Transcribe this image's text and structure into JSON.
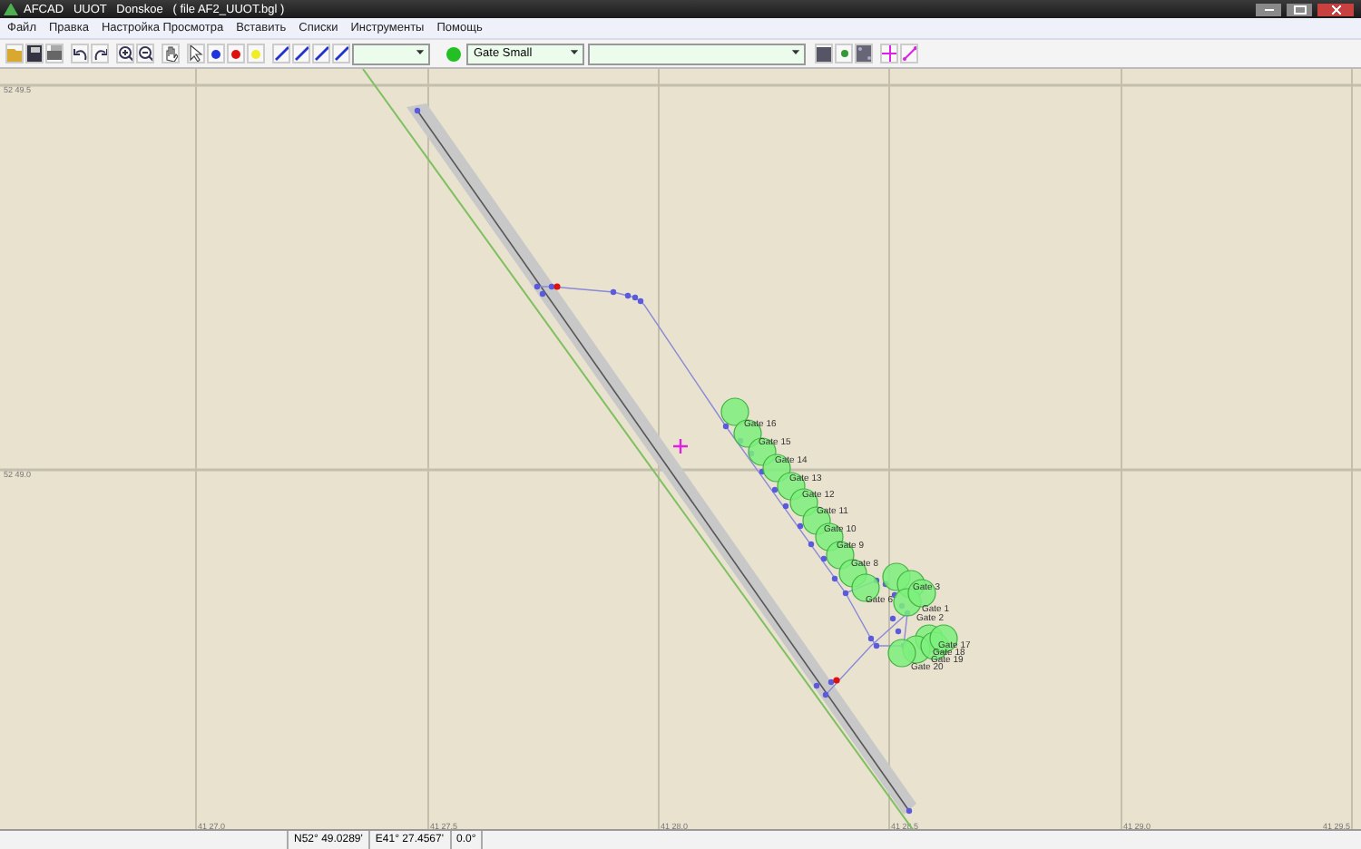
{
  "window": {
    "title": "AFCAD   UUOT   Donskoe   ( file AF2_UUOT.bgl )"
  },
  "menu": [
    "Файл",
    "Правка",
    "Настройка Просмотра",
    "Вставить",
    "Списки",
    "Инструменты",
    "Помощь"
  ],
  "toolbar": {
    "gate_type": "Gate Small"
  },
  "map": {
    "lat_labels": [
      "52 49.5",
      "52 49.0"
    ],
    "lon_labels": [
      "41 27.0",
      "41 27.5",
      "41 28.0",
      "41 28.5",
      "41 29.0",
      "41 29.5"
    ],
    "gates": [
      "Gate 16",
      "Gate 15",
      "Gate 14",
      "Gate 13",
      "Gate 12",
      "Gate 11",
      "Gate 10",
      "Gate 9",
      "Gate 8",
      "Gate 6",
      "Gate 3",
      "Gate 1",
      "Gate 2",
      "Gate 17",
      "Gate 18",
      "Gate 19",
      "Gate 20"
    ]
  },
  "status_bar": [
    "N52° 49.0289'",
    "E41° 27.4567'",
    "0.0°"
  ]
}
